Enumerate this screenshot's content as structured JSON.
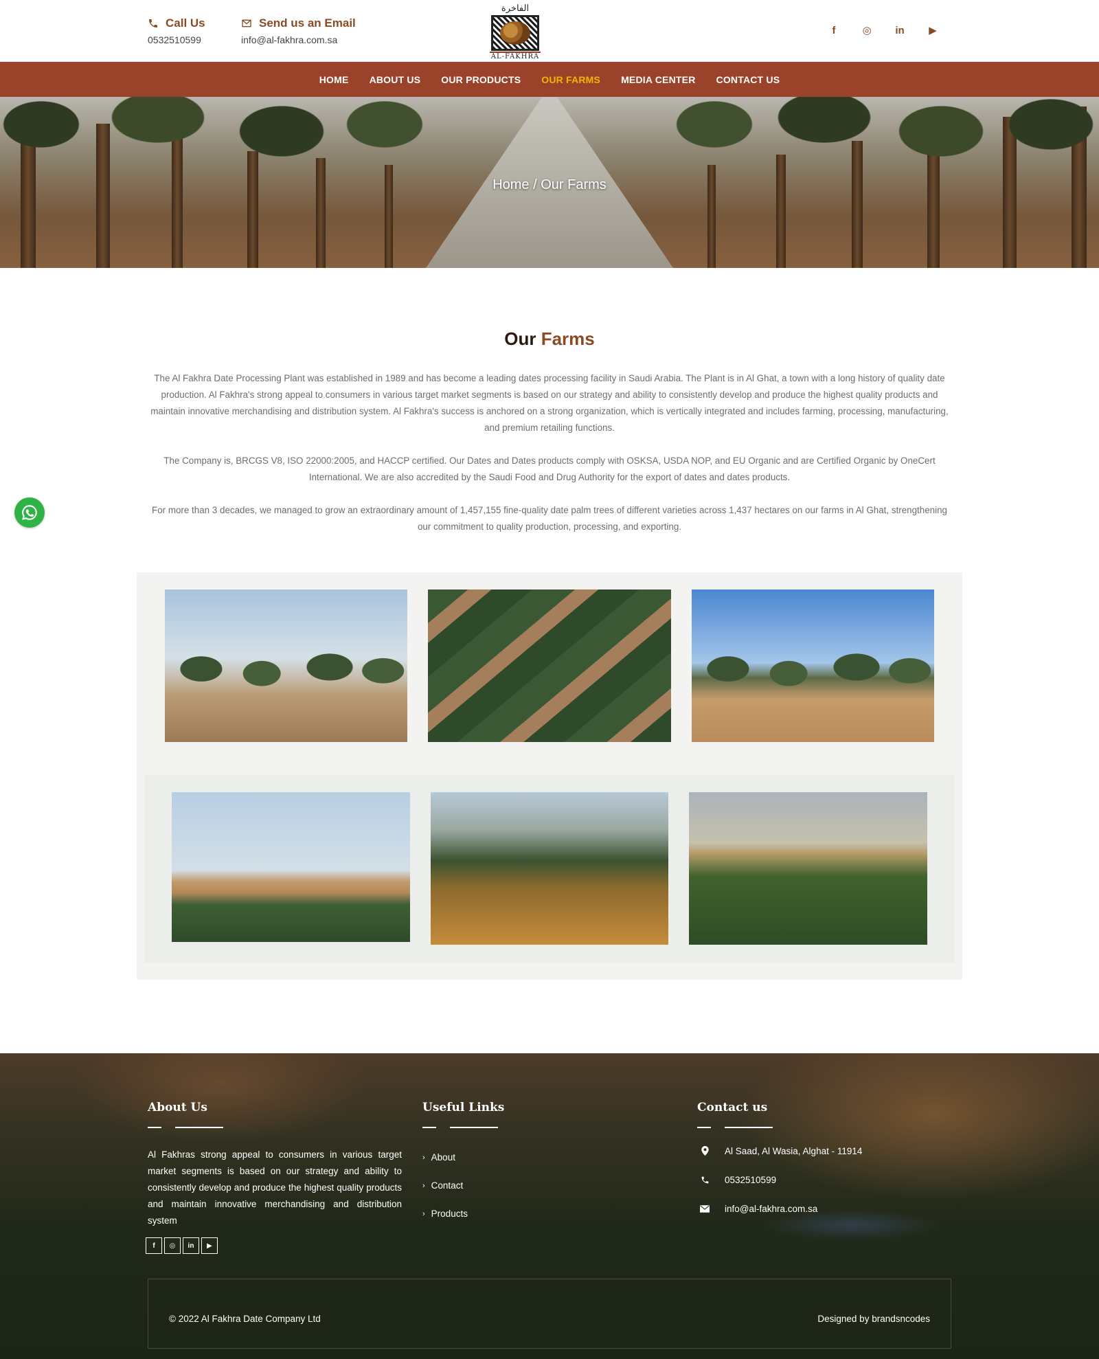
{
  "colors": {
    "brand_brown": "#8a4a22",
    "nav_bg": "#9b432a",
    "nav_active": "#f4b400",
    "whatsapp": "#2fb344"
  },
  "header": {
    "call": {
      "label": "Call Us",
      "value": "0532510599",
      "icon": "phone-icon"
    },
    "email": {
      "label": "Send us an Email",
      "value": "info@al-fakhra.com.sa",
      "icon": "envelope-icon"
    },
    "logo": {
      "arabic": "الفاخرة",
      "english": "AL-FAKHRA"
    },
    "socials": [
      {
        "name": "facebook-icon",
        "glyph": "f"
      },
      {
        "name": "instagram-icon",
        "glyph": "◎"
      },
      {
        "name": "linkedin-icon",
        "glyph": "in"
      },
      {
        "name": "youtube-icon",
        "glyph": "▶"
      }
    ]
  },
  "nav": {
    "items": [
      {
        "label": "HOME"
      },
      {
        "label": "ABOUT US"
      },
      {
        "label": "OUR PRODUCTS"
      },
      {
        "label": "OUR FARMS",
        "active": true
      },
      {
        "label": "MEDIA CENTER"
      },
      {
        "label": "CONTACT US"
      }
    ]
  },
  "hero": {
    "breadcrumb": "Home / Our Farms"
  },
  "intro": {
    "title_plain": "Our",
    "title_accent": "Farms",
    "paragraphs": [
      "The Al Fakhra Date Processing Plant was established in 1989 and has become a leading dates processing facility in Saudi Arabia. The Plant is in Al Ghat, a town with a long history of quality date production. Al Fakhra's strong appeal to consumers in various target market segments is based on our strategy and ability to consistently develop and produce the highest quality products and maintain innovative merchandising and distribution system. Al Fakhra's success is anchored on a strong organization, which is vertically integrated and includes farming, processing, manufacturing, and premium retailing functions.",
      "The Company is, BRCGS V8, ISO 22000:2005, and HACCP certified. Our Dates and Dates products comply with OSKSA, USDA NOP, and EU Organic and are Certified Organic by OneCert International. We are also accredited by the Saudi Food and Drug Authority for the export of dates and dates products.",
      "For more than 3 decades, we managed to grow an extraordinary amount of 1,457,155 fine-quality date palm trees of different varieties across 1,437 hectares on our farms in Al Ghat, strengthening our commitment to quality production, processing, and exporting."
    ]
  },
  "footer": {
    "about": {
      "title": "About Us",
      "text": "Al Fakhras strong appeal to consumers in various target market segments is based on our strategy and ability to consistently develop and produce the highest quality products and maintain innovative merchandising and distribution system"
    },
    "links": {
      "title": "Useful Links",
      "items": [
        "About",
        "Contact",
        "Products"
      ]
    },
    "contact": {
      "title": "Contact us",
      "address": "Al Saad, Al Wasia, Alghat - 11914",
      "phone": "0532510599",
      "email": "info@al-fakhra.com.sa"
    },
    "copyright": "© 2022 Al Fakhra Date Company Ltd",
    "designed_by": "Designed by brandsncodes"
  }
}
